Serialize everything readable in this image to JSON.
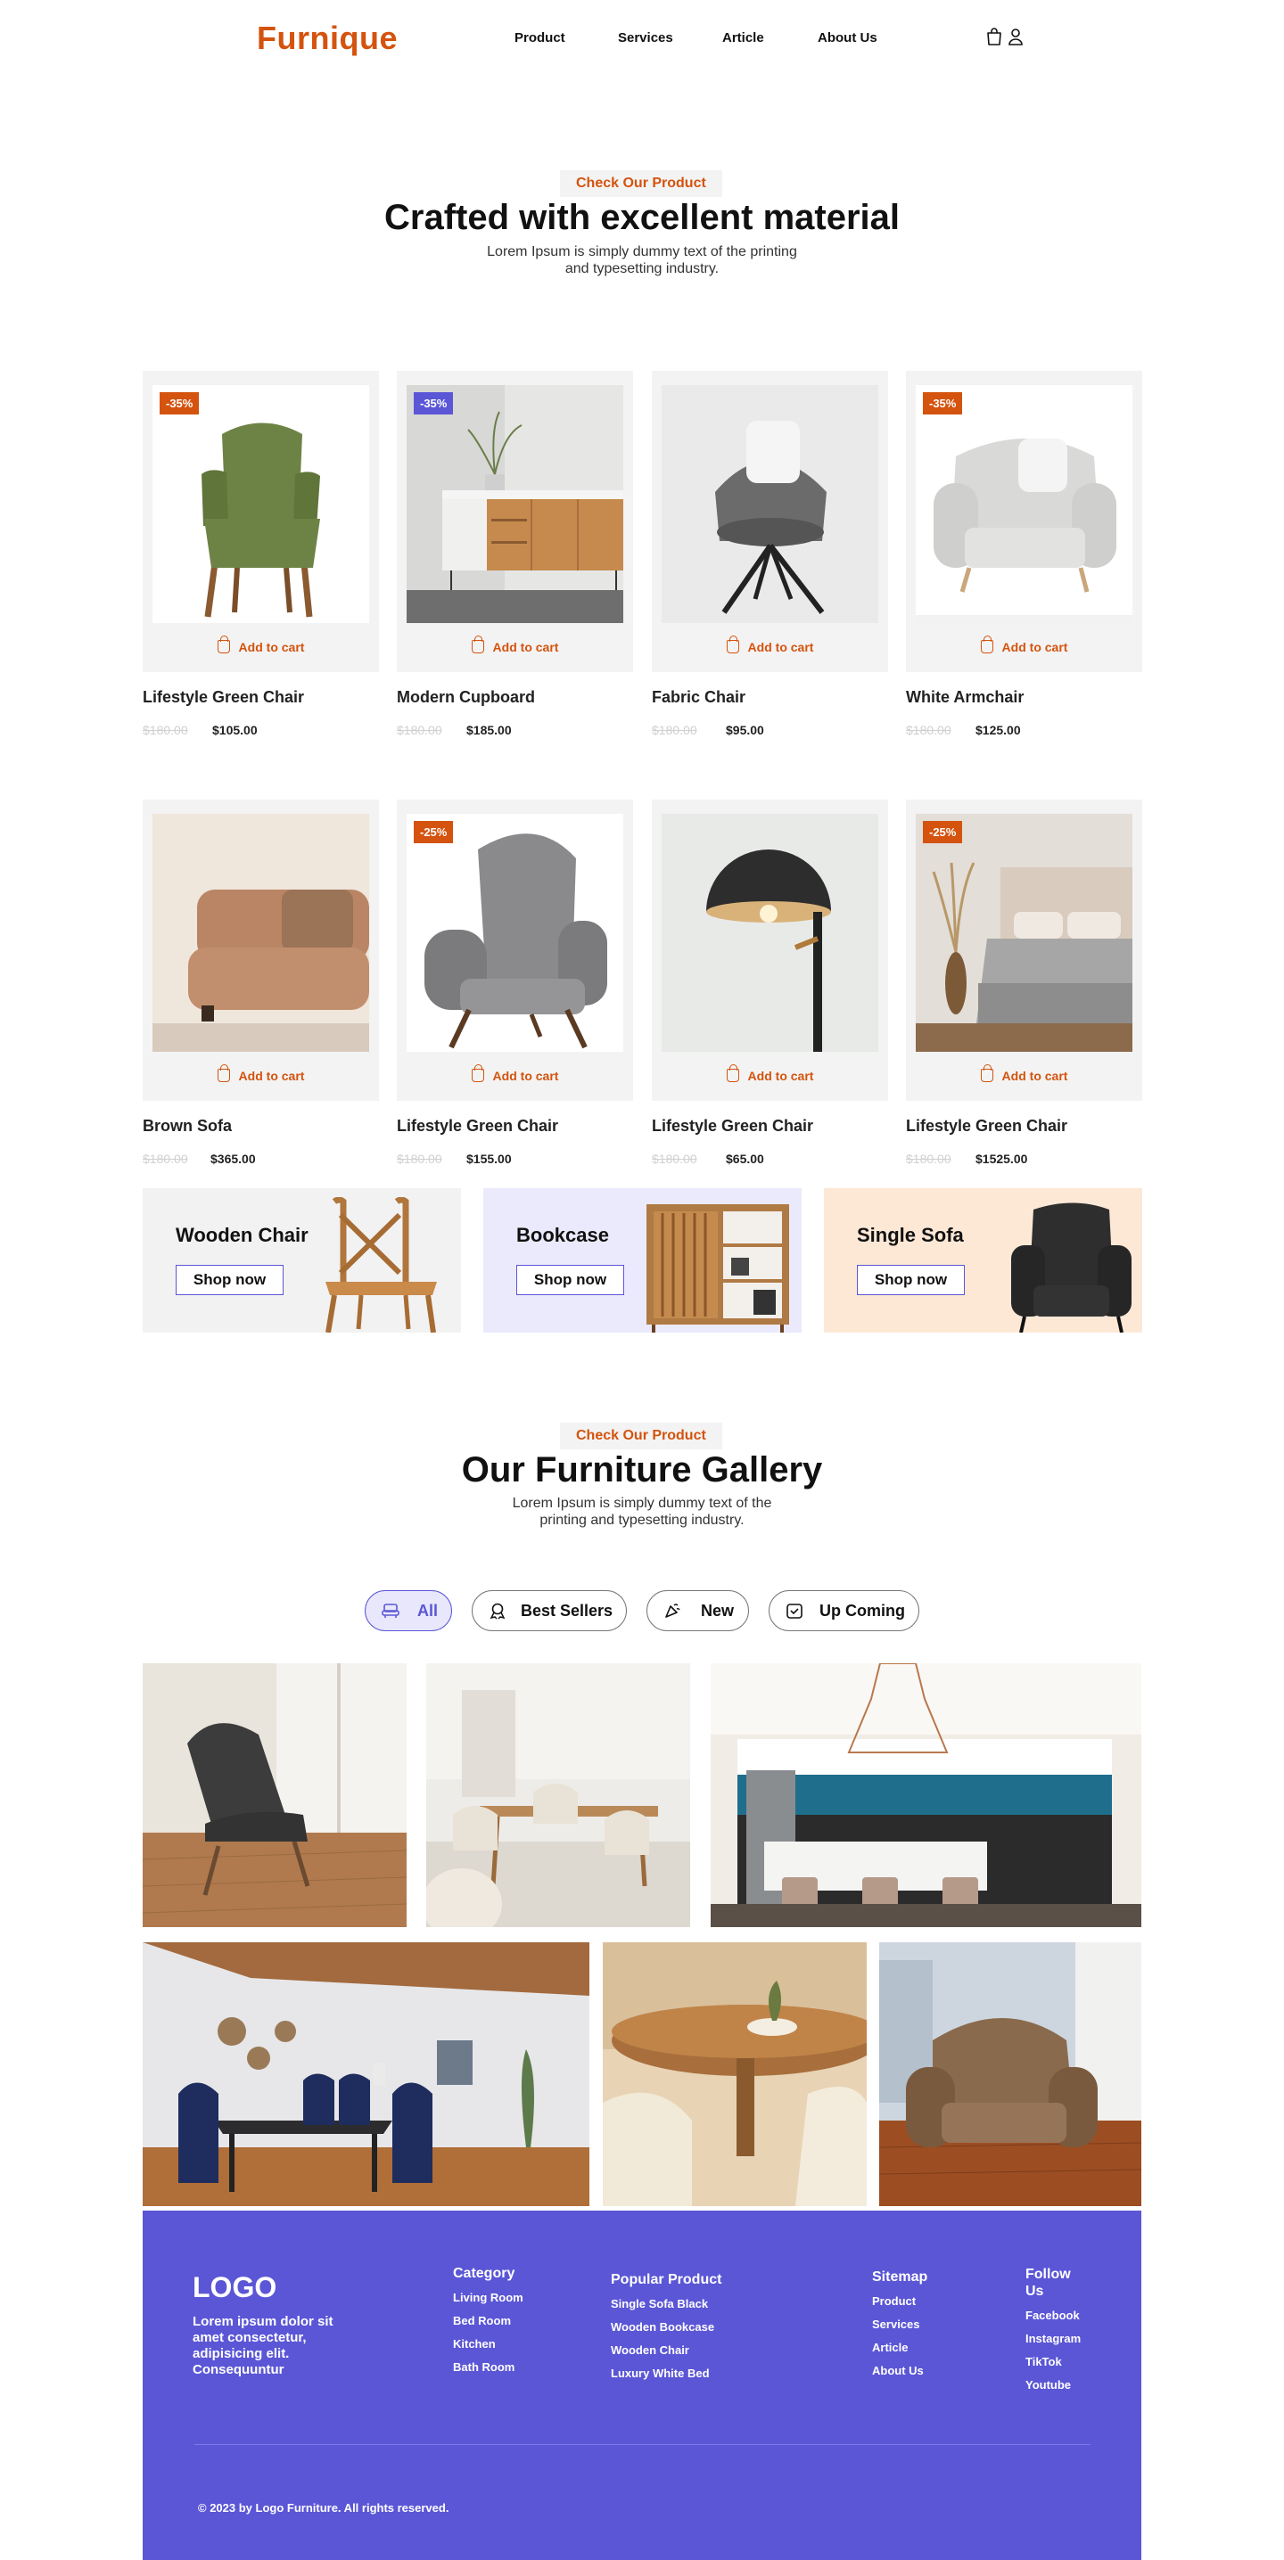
{
  "nav": {
    "brand": "Furnique",
    "menu": [
      "Product",
      "Services",
      "Article",
      "About Us"
    ]
  },
  "colors": {
    "accent": "#d4530e",
    "brand_purple": "#5b56d6",
    "card_bg": "#f3f3f3"
  },
  "products_section": {
    "pill": "Check Our Product",
    "title": "Crafted with excellent material",
    "subtitle_line1": "Lorem Ipsum is simply dummy text of the printing",
    "subtitle_line2": "and typesetting industry."
  },
  "add_to_cart": "Add to cart",
  "products": [
    {
      "name": "Lifestyle Green Chair",
      "old_price": "$180.00",
      "price": "$105.00",
      "badge": "-35%",
      "badge_color": "#d4530e"
    },
    {
      "name": "Modern Cupboard",
      "old_price": "$180.00",
      "price": "$185.00",
      "badge": "-35%",
      "badge_color": "#5b56d6"
    },
    {
      "name": "Fabric Chair",
      "old_price": "$180.00",
      "price": "$95.00",
      "badge": "",
      "badge_color": ""
    },
    {
      "name": "White Armchair",
      "old_price": "$180.00",
      "price": "$125.00",
      "badge": "-35%",
      "badge_color": "#d4530e"
    },
    {
      "name": "Brown Sofa",
      "old_price": "$180.00",
      "price": "$365.00",
      "badge": "",
      "badge_color": ""
    },
    {
      "name": "Lifestyle Green Chair",
      "old_price": "$180.00",
      "price": "$155.00",
      "badge": "-25%",
      "badge_color": "#d4530e"
    },
    {
      "name": "Lifestyle Green Chair",
      "old_price": "$180.00",
      "price": "$65.00",
      "badge": "",
      "badge_color": ""
    },
    {
      "name": "Lifestyle Green Chair",
      "old_price": "$180.00",
      "price": "$1525.00",
      "badge": "-25%",
      "badge_color": "#d4530e"
    }
  ],
  "promos": [
    {
      "title": "Wooden Chair",
      "button": "Shop now",
      "bg": "#f2f2f2"
    },
    {
      "title": "Bookcase",
      "button": "Shop now",
      "bg": "#ebeafc"
    },
    {
      "title": "Single Sofa",
      "button": "Shop now",
      "bg": "#fde8d6"
    }
  ],
  "gallery_section": {
    "pill": "Check Our Product",
    "title": "Our Furniture Gallery",
    "subtitle_line1": "Lorem Ipsum is simply dummy text of the",
    "subtitle_line2": "printing and typesetting industry."
  },
  "filters": [
    "All",
    "Best Sellers",
    "New",
    "Up Coming"
  ],
  "footer": {
    "logo": "LOGO",
    "description": "Lorem ipsum dolor sit amet consectetur, adipisicing elit. Consequuntur",
    "category": {
      "heading": "Category",
      "links": [
        "Living Room",
        "Bed Room",
        "Kitchen",
        "Bath Room"
      ]
    },
    "popular": {
      "heading": "Popular Product",
      "links": [
        "Single Sofa Black",
        "Wooden Bookcase",
        "Wooden Chair",
        "Luxury White Bed"
      ]
    },
    "sitemap": {
      "heading": "Sitemap",
      "links": [
        "Product",
        "Services",
        "Article",
        "About Us"
      ]
    },
    "follow": {
      "heading": "Follow Us",
      "links": [
        "Facebook",
        "Instagram",
        "TikTok",
        "Youtube"
      ]
    },
    "copyright": "© 2023 by Logo Furniture. All rights reserved."
  }
}
